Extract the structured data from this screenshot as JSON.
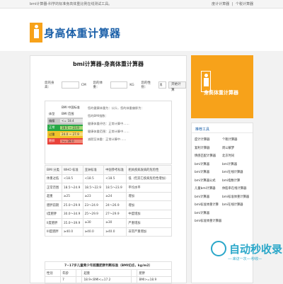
{
  "topbar": {
    "left": "bmi计算器-科学的标准身高体重比例在线测试工具。",
    "links": [
      "度计计算器",
      "|",
      "个税计算器"
    ]
  },
  "header": {
    "logo_text": "身高体重计算器"
  },
  "main": {
    "title": "bmi计算器-身高体重计算器",
    "form": {
      "height_label": "您的身高：",
      "height_unit": "CM",
      "weight_label": "您的体重：",
      "weight_unit": "KG",
      "gender_label": "您的性别：",
      "gender_value": "男",
      "submit": "开始计算"
    },
    "bmi_box": {
      "header": [
        "BMI 中国标准",
        ""
      ],
      "cols": [
        "体型",
        "BMI 范围"
      ],
      "rows": [
        {
          "type": "偏瘦",
          "range": "<= 18.4",
          "color": "#c9c9c9"
        },
        {
          "type": "正常",
          "range": "18.5 ~ 23.9",
          "color": "#27a846"
        },
        {
          "type": "过重",
          "range": "24.0 ~ 27.9",
          "color": "#f2c42b"
        },
        {
          "type": "肥胖",
          "range": ">= 28.0",
          "color": "#e9423a"
        }
      ],
      "results": [
        "您的健康体重为：公斤，您的体重偏胖为：",
        "您的BMI指数：",
        "健康体重评估：正常计算中……",
        "健康体重范围：正常计算中……",
        "减肥至体重：正常计算中……"
      ]
    },
    "std_table": {
      "headers": [
        "BMI 分类",
        "WHO 标准",
        "亚洲标准",
        "中国参考标准",
        "相关疾病发病的危险性"
      ],
      "rows": [
        [
          "体重过低",
          "<18.5",
          "<18.5",
          "<18.5",
          "低（但其它疾病危险性增加）"
        ],
        [
          "正常范围",
          "18.5～24.9",
          "18.5～22.9",
          "18.5～23.9",
          "平均水平"
        ],
        [
          "超重",
          "≥25",
          "≥23",
          "≥24",
          "增加"
        ],
        [
          "肥胖前期",
          "25.0～29.9",
          "23～24.9",
          "24～26.9",
          "增加"
        ],
        [
          "I度肥胖",
          "30.0～34.9",
          "25～29.9",
          "27～29.9",
          "中度增加"
        ],
        [
          "II度肥胖",
          "35.0～39.9",
          "≥30",
          "≥30",
          "严重增加"
        ],
        [
          "III度肥胖",
          "≥40.0",
          "≥40.0",
          "≥40.0",
          "非常严重增加"
        ]
      ]
    },
    "kid_table": {
      "caption": "7~17岁儿童青少年超重肥胖判断标准（BMI切点，kg/m2）",
      "headers": [
        "性别",
        "年龄",
        "",
        "超重",
        "",
        "肥胖"
      ],
      "rows": [
        [
          "",
          "7",
          "",
          "18.9<BMI<=17.2",
          "",
          "BMI>=18.9"
        ]
      ]
    }
  },
  "side_banner": {
    "text": "身高体重计算器"
  },
  "side_tools": {
    "title": "推荐工具",
    "items": [
      "度计计算器",
      "个税计算器",
      "复利计算器",
      "周公解梦",
      "情感匹配计算器",
      "北京时间",
      "bmi计算器",
      "bmi计算器",
      "bmi计算器",
      "bmi在线计算器",
      "bmi计算器公式",
      "bmi指数计算",
      "儿童bmi计算器",
      "体脂率在线计算器",
      "bmi计算器",
      "bmi标准体重计算器",
      "bmi标准体重计算",
      "bmi在线计算器",
      "bmi计算器",
      "",
      "bmi标准体重计算器",
      ""
    ]
  },
  "watermark": {
    "text": "自动秒收录",
    "sub": "—·来访一次—·秒收—"
  }
}
